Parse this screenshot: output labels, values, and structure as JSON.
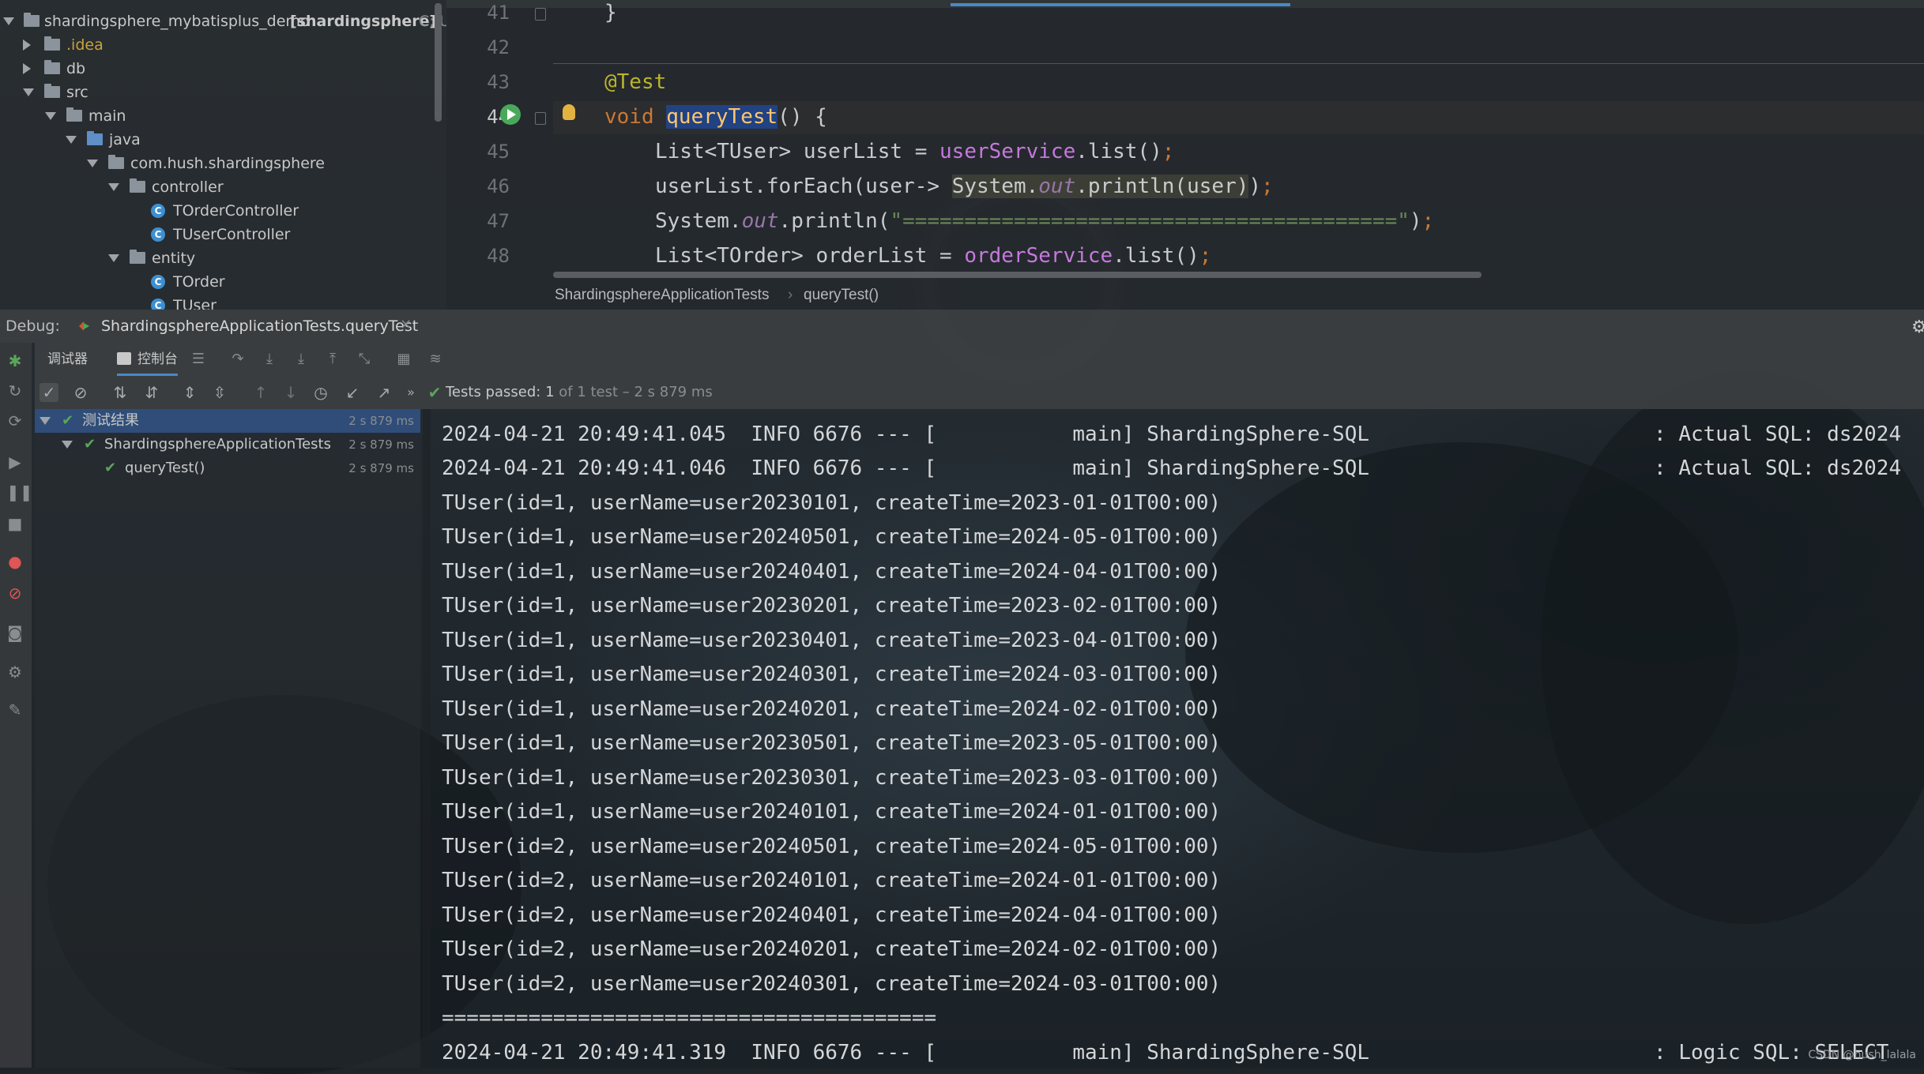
{
  "project_tree": {
    "root": {
      "label": "shardingsphere_mybatisplus_demo",
      "module": "[shardingsphere]",
      "path": "C:\\U"
    },
    "items": [
      {
        "label": ".idea"
      },
      {
        "label": "db"
      },
      {
        "label": "src"
      },
      {
        "label": "main"
      },
      {
        "label": "java"
      },
      {
        "label": "com.hush.shardingsphere"
      },
      {
        "label": "controller"
      },
      {
        "label": "TOrderController"
      },
      {
        "label": "TUserController"
      },
      {
        "label": "entity"
      },
      {
        "label": "TOrder"
      },
      {
        "label": "TUser"
      }
    ]
  },
  "editor": {
    "line_numbers": [
      "41",
      "42",
      "43",
      "44",
      "45",
      "46",
      "47",
      "48"
    ],
    "breadcrumb": [
      "ShardingsphereApplicationTests",
      "queryTest()"
    ]
  },
  "debug": {
    "label": "Debug:",
    "tab": "ShardingsphereApplicationTests.queryTest",
    "tabs": [
      "调试器",
      "控制台"
    ]
  },
  "test_status": {
    "passed": "Tests passed:",
    "count": "1",
    "detail": "of 1 test – 2 s 879 ms"
  },
  "test_tree": [
    {
      "label": "测试结果",
      "time": "2 s 879 ms"
    },
    {
      "label": "ShardingsphereApplicationTests",
      "time": "2 s 879 ms"
    },
    {
      "label": "queryTest()",
      "time": "2 s 879 ms"
    }
  ],
  "console_lines": [
    "2024-04-21 20:49:41.045  INFO 6676 --- [           main] ShardingSphere-SQL                       : Actual SQL: ds2024",
    "2024-04-21 20:49:41.046  INFO 6676 --- [           main] ShardingSphere-SQL                       : Actual SQL: ds2024",
    "TUser(id=1, userName=user20230101, createTime=2023-01-01T00:00)",
    "TUser(id=1, userName=user20240501, createTime=2024-05-01T00:00)",
    "TUser(id=1, userName=user20240401, createTime=2024-04-01T00:00)",
    "TUser(id=1, userName=user20230201, createTime=2023-02-01T00:00)",
    "TUser(id=1, userName=user20230401, createTime=2023-04-01T00:00)",
    "TUser(id=1, userName=user20240301, createTime=2024-03-01T00:00)",
    "TUser(id=1, userName=user20240201, createTime=2024-02-01T00:00)",
    "TUser(id=1, userName=user20230501, createTime=2023-05-01T00:00)",
    "TUser(id=1, userName=user20230301, createTime=2023-03-01T00:00)",
    "TUser(id=1, userName=user20240101, createTime=2024-01-01T00:00)",
    "TUser(id=2, userName=user20240501, createTime=2024-05-01T00:00)",
    "TUser(id=2, userName=user20240101, createTime=2024-01-01T00:00)",
    "TUser(id=2, userName=user20240401, createTime=2024-04-01T00:00)",
    "TUser(id=2, userName=user20240201, createTime=2024-02-01T00:00)",
    "TUser(id=2, userName=user20240301, createTime=2024-03-01T00:00)",
    "========================================",
    "2024-04-21 20:49:41.319  INFO 6676 --- [           main] ShardingSphere-SQL                       : Logic SQL: SELECT"
  ],
  "watermark": "CSDN @hush_lalala",
  "colors": {
    "accent": "#4a88c7",
    "pass_green": "#5aa65a",
    "selection": "#2f4d78"
  }
}
